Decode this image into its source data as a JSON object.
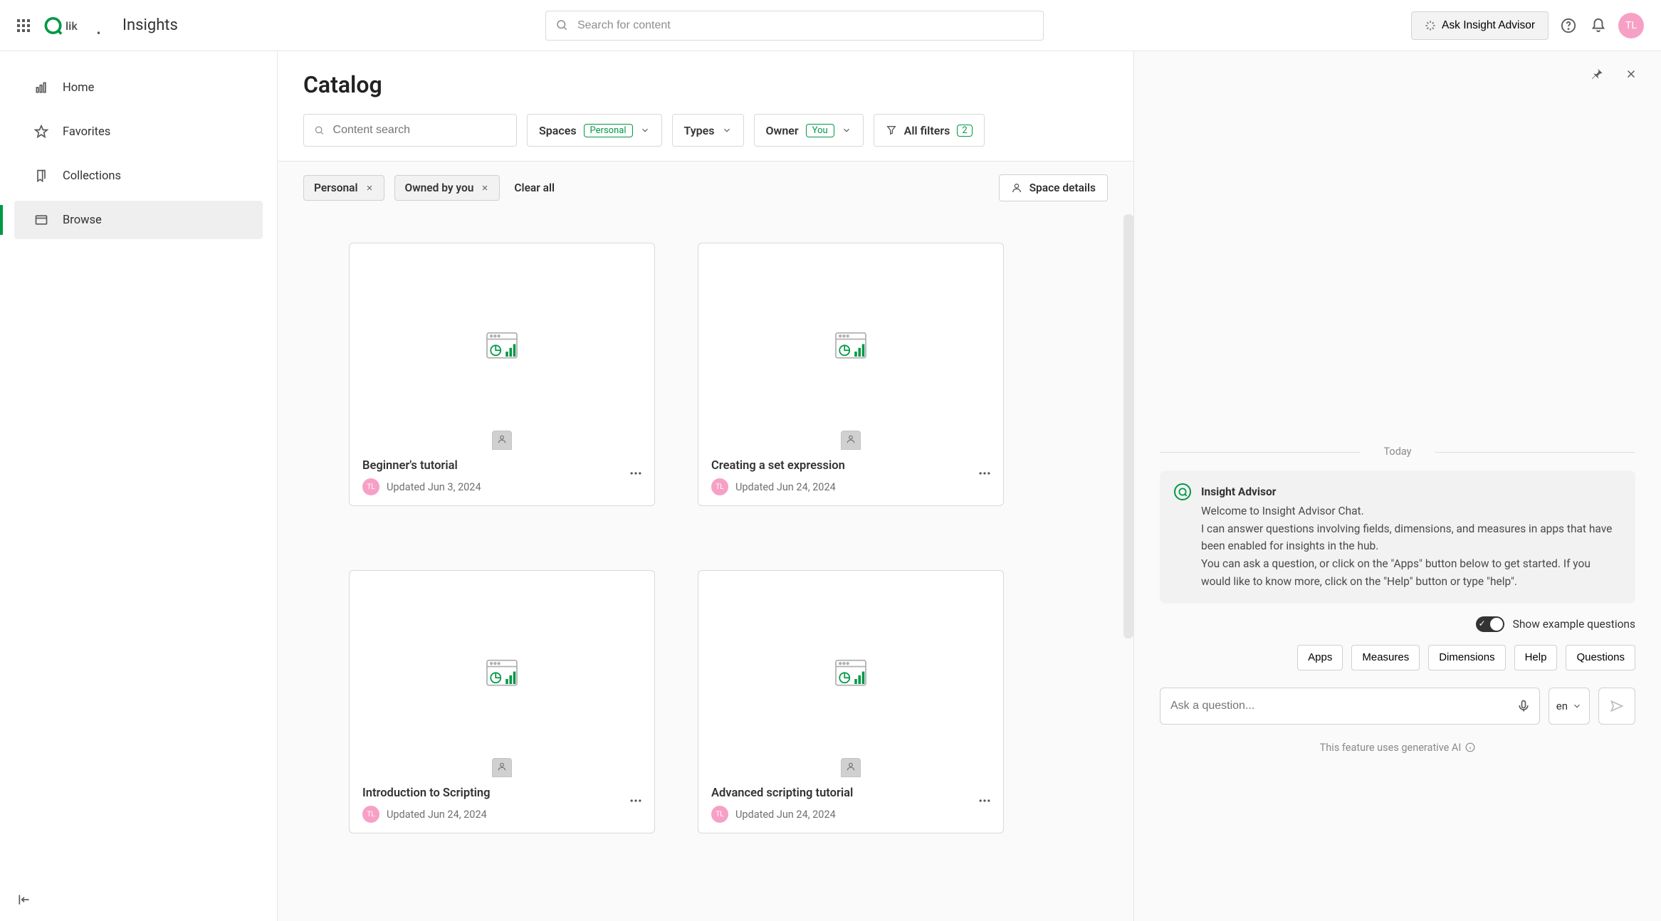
{
  "header": {
    "app_name": "Insights",
    "search_placeholder": "Search for content",
    "ask_button": "Ask Insight Advisor",
    "avatar_initials": "TL"
  },
  "sidebar": {
    "items": [
      {
        "label": "Home"
      },
      {
        "label": "Favorites"
      },
      {
        "label": "Collections"
      },
      {
        "label": "Browse"
      }
    ]
  },
  "catalog": {
    "title": "Catalog",
    "content_search_placeholder": "Content search",
    "filters": {
      "spaces_label": "Spaces",
      "spaces_value": "Personal",
      "types_label": "Types",
      "owner_label": "Owner",
      "owner_value": "You",
      "allfilters_label": "All filters",
      "allfilters_count": "2"
    },
    "chips": [
      {
        "label": "Personal"
      },
      {
        "label": "Owned by you"
      }
    ],
    "clear_all": "Clear all",
    "space_details": "Space details",
    "cards": [
      {
        "title": "Beginner's tutorial",
        "updated": "Updated Jun 3, 2024",
        "avatar": "TL"
      },
      {
        "title": "Creating a set expression",
        "updated": "Updated Jun 24, 2024",
        "avatar": "TL"
      },
      {
        "title": "Introduction to Scripting",
        "updated": "Updated Jun 24, 2024",
        "avatar": "TL"
      },
      {
        "title": "Advanced scripting tutorial",
        "updated": "Updated Jun 24, 2024",
        "avatar": "TL"
      }
    ]
  },
  "chat": {
    "today": "Today",
    "bot_name": "Insight Advisor",
    "lines": [
      "Welcome to Insight Advisor Chat.",
      "I can answer questions involving fields, dimensions, and measures in apps that have been enabled for insights in the hub.",
      "You can ask a question, or click on the \"Apps\" button below to get started. If you would like to know more, click on the \"Help\" button or type \"help\"."
    ],
    "show_example": "Show example questions",
    "quick_buttons": [
      "Apps",
      "Measures",
      "Dimensions",
      "Help",
      "Questions"
    ],
    "ask_placeholder": "Ask a question...",
    "lang": "en",
    "genai_notice": "This feature uses generative AI"
  }
}
